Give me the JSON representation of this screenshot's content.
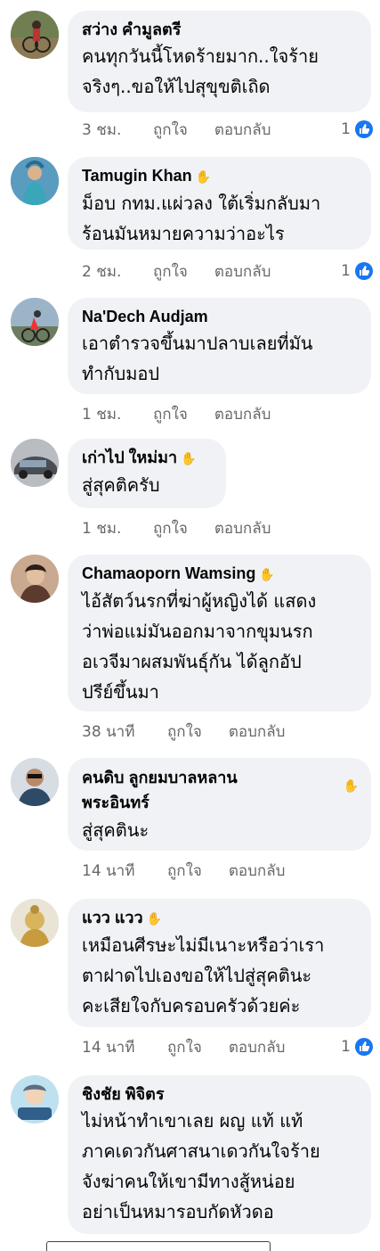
{
  "labels": {
    "like": "ถูกใจ",
    "reply": "ตอบกลับ"
  },
  "comments": [
    {
      "name": "สว่าง คำมูลตรี",
      "text": "คนทุกวันนี้โหดร้ายมาก..ใจร้าย\nจริงๆ..ขอให้ไปสุขุขติเถิด",
      "time": "3 ชม.",
      "reactions": "1",
      "has_wave": false,
      "avatar": "bicycle-photo"
    },
    {
      "name": "Tamugin Khan",
      "text": "ม็อบ กทม.แผ่วลง ใต้เริ่มกลับมา\nร้อนมันหมายความว่าอะไร",
      "time": "2 ชม.",
      "reactions": "1",
      "has_wave": true,
      "avatar": "costume-photo"
    },
    {
      "name": "Na'Dech Audjam",
      "text": "เอาตำรวจขึ้นมาปลาบเลยที่มัน\nทำกับมอป",
      "time": "1 ชม.",
      "reactions": "",
      "has_wave": false,
      "avatar": "cyclist-photo"
    },
    {
      "name": "เก่าไป ใหม่มา",
      "text": "สู่สุคติครับ",
      "time": "1 ชม.",
      "reactions": "",
      "has_wave": true,
      "avatar": "car-photo"
    },
    {
      "name": "Chamaoporn Wamsing",
      "text": "ไอ้สัตว์นรกที่ฆ่าผู้หญิงได้ แสดง\nว่าพ่อแม่มันออกมาจากขุมนรก\nอเวจีมาผสมพันธุ์กัน ได้ลูกอัป\nปรีย์ขึ้นมา",
      "time": "38 นาที",
      "reactions": "",
      "has_wave": true,
      "avatar": "woman-photo"
    },
    {
      "name": "คนดิบ ลูกยมบาลหลาน\nพระอินทร์",
      "text": "สู่สุคตินะ",
      "time": "14 นาที",
      "reactions": "",
      "has_wave": true,
      "avatar": "man-sunglasses-photo"
    },
    {
      "name": "แวว แวว",
      "text": "เหมือนศีรษะไม่มีเนาะหรือว่าเรา\nตาฝาดไปเองขอให้ไปสู่สุคตินะ\nคะเสียใจกับครอบครัวด้วยค่ะ",
      "time": "14 นาที",
      "reactions": "1",
      "has_wave": true,
      "avatar": "buddha-photo"
    },
    {
      "name": "ชิงชัย พิจิตร",
      "text": "ไม่หน้าทำเขาเลย ผญ แท้ แท้\nภาคเดวกันศาสนาเดวกันใจร้าย\nจังฆ่าคนให้เขามีทางสู้หน่อย\nอย่าเป็นหมารอบกัดหัวดอ",
      "time": "",
      "reactions": "",
      "has_wave": false,
      "avatar": "cartoon-avatar"
    }
  ],
  "colors": {
    "bubble": "#f0f2f5",
    "meta": "#65676b",
    "like_blue": "#1877f2"
  }
}
